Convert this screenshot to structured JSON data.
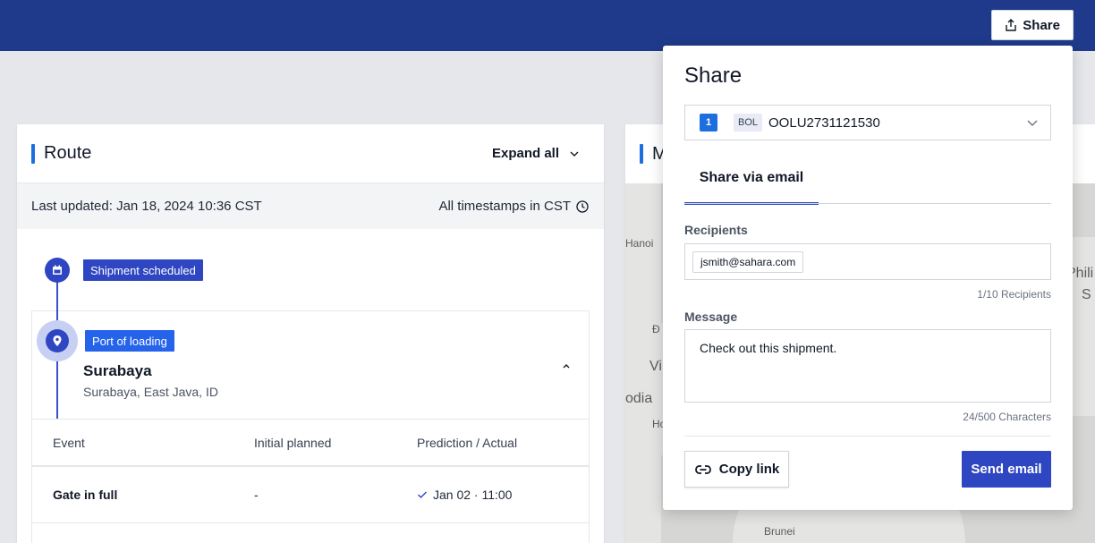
{
  "header": {
    "share_label": "Share",
    "share_icon": "share-icon",
    "colors": {
      "nav": "#1f3a8a",
      "accent": "#2f46c2"
    }
  },
  "route": {
    "title": "Route",
    "expand_all_label": "Expand all",
    "last_updated": "Last updated: Jan 18, 2024 10:36 CST",
    "timestamps_note": "All timestamps in CST",
    "milestones": [
      {
        "label": "Shipment scheduled",
        "icon": "calendar-icon"
      },
      {
        "label": "Port of loading",
        "icon": "location-pin-icon"
      }
    ],
    "port": {
      "city": "Surabaya",
      "region": "Surabaya, East Java, ID"
    },
    "table": {
      "headers": [
        "Event",
        "Initial planned",
        "Prediction / Actual"
      ],
      "rows": [
        {
          "event": "Gate in full",
          "initial": "-",
          "actual": "Jan 02 · 11:00"
        }
      ]
    }
  },
  "map": {
    "title_fragment": "M",
    "labels": [
      "Hanoi",
      "Đ",
      "Vi",
      "odia",
      "Ho",
      "Brunei",
      "Phili",
      "S"
    ]
  },
  "share_panel": {
    "title": "Share",
    "shipment_index": "1",
    "doc_type": "BOL",
    "doc_number": "OOLU2731121530",
    "tab_label": "Share via email",
    "recipients_label": "Recipients",
    "recipients": [
      "jsmith@sahara.com"
    ],
    "recipients_count": "1/10 Recipients",
    "message_label": "Message",
    "message_value": "Check out this shipment.",
    "message_count": "24/500 Characters",
    "copy_link_label": "Copy link",
    "send_email_label": "Send email"
  }
}
